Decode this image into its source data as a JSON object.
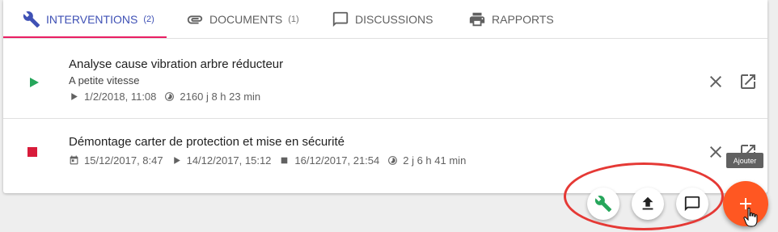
{
  "tabs": [
    {
      "label": "INTERVENTIONS",
      "count": "(2)",
      "icon": "wrench-icon",
      "active": true
    },
    {
      "label": "DOCUMENTS",
      "count": "(1)",
      "icon": "paperclip-icon",
      "active": false
    },
    {
      "label": "DISCUSSIONS",
      "count": "",
      "icon": "chat-icon",
      "active": false
    },
    {
      "label": "RAPPORTS",
      "count": "",
      "icon": "printer-icon",
      "active": false
    }
  ],
  "colors": {
    "tab_active": "#3f51b5",
    "tab_indicator": "#e91e63",
    "status_running": "#26a65b",
    "status_stopped": "#d81b3a",
    "fab": "#ff5722",
    "wrench_green": "#26a65b",
    "highlight": "#e53935"
  },
  "interventions": [
    {
      "title": "Analyse cause vibration arbre réducteur",
      "subtitle": "A petite vitesse",
      "status": "running",
      "start": "1/2/2018, 11:08",
      "duration": "2160 j  8 h  23 min"
    },
    {
      "title": "Démontage carter de protection et mise en sécurité",
      "status": "stopped",
      "scheduled": "15/12/2017, 8:47",
      "start": "14/12/2017, 15:12",
      "end": "16/12/2017, 21:54",
      "duration": "2 j  6 h  41 min"
    }
  ],
  "tooltip": "Ajouter",
  "speed_dial": {
    "items": [
      {
        "icon": "wrench-icon"
      },
      {
        "icon": "upload-icon"
      },
      {
        "icon": "chat-icon"
      }
    ],
    "main_icon": "plus-icon"
  }
}
